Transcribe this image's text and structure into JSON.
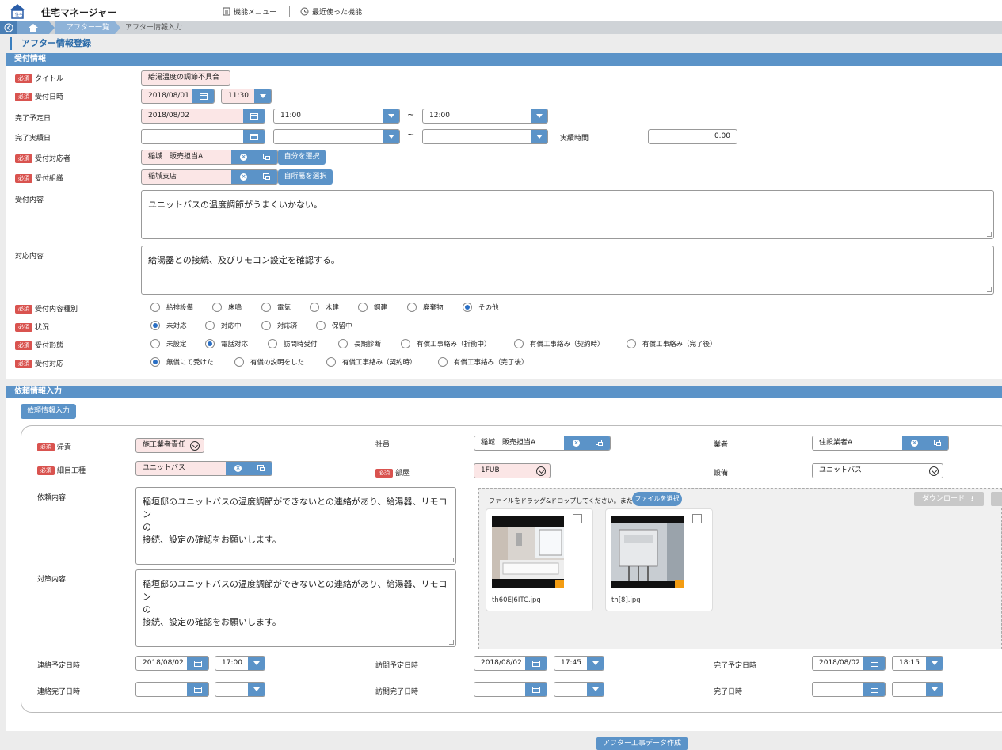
{
  "app": {
    "name": "住宅マネージャー"
  },
  "topmenu": {
    "function_menu": "機能メニュー",
    "recent": "最近使った機能"
  },
  "breadcrumb": {
    "items": [
      "アフター一覧",
      "アフター情報入力"
    ]
  },
  "page_title": "アフター情報登録",
  "reception": {
    "section_title": "受付情報",
    "required_badge": "必須",
    "title_label": "タイトル",
    "title_value": "給湯温度の調節不具合",
    "date_label": "受付日時",
    "date_value": "2018/08/01",
    "time_value": "11:30",
    "planned_label": "完了予定日",
    "planned_date": "2018/08/02",
    "planned_from": "11:00",
    "tilde": "~",
    "planned_to": "12:00",
    "actual_label": "完了実績日",
    "actual_date": "",
    "actual_from": "",
    "actual_to": "",
    "actual_hours_label": "実績時間",
    "actual_hours_value": "0.00",
    "handler_label": "受付対応者",
    "handler_value": "稲城　販売担当A",
    "handler_select_self": "自分を選択",
    "org_label": "受付組織",
    "org_value": "稲城支店",
    "org_select_own": "自所屬を選択",
    "content_label": "受付内容",
    "content_value": "ユニットバスの温度調節がうまくいかない。",
    "response_label": "対応内容",
    "response_value": "給湯器との接続、及びリモコン設定を確認する。",
    "category_label": "受付内容種別",
    "category_options": [
      "給排設備",
      "床鳴",
      "電気",
      "木建",
      "鋼建",
      "廃棄物",
      "その他"
    ],
    "category_selected": "その他",
    "status_label": "状況",
    "status_options": [
      "未対応",
      "対応中",
      "対応済",
      "保留中"
    ],
    "status_selected": "未対応",
    "form_label": "受付形態",
    "form_options": [
      "未設定",
      "電話対応",
      "訪問時受付",
      "長期診断",
      "有償工事絡み（折衝中）",
      "有償工事絡み（契約時）",
      "有償工事絡み（完了後）"
    ],
    "form_selected": "電話対応",
    "resp_label": "受付対応",
    "resp_options": [
      "無償にて受けた",
      "有償の説明をした",
      "有償工事絡み（契約時）",
      "有償工事絡み（完了後）"
    ],
    "resp_selected": "無償にて受けた"
  },
  "request": {
    "section_title": "依頼情報入力",
    "tab_label": "依頼情報入力",
    "attribution_label": "帰責",
    "attribution_value": "施工業者責任",
    "employee_label": "社員",
    "employee_value": "稲城　販売担当A",
    "vendor_label": "業者",
    "vendor_value": "住設業者A",
    "work_label": "細目工種",
    "work_value": "ユニットバス",
    "room_label": "部屋",
    "room_value": "1FUB",
    "equipment_label": "設備",
    "equipment_value": "ユニットバス",
    "request_label": "依頼内容",
    "request_lines": [
      "稲垣邸のユニットバスの温度調節ができないとの連絡があり、給湯器、リモコン",
      "の",
      "接続、設定の確認をお願いします。"
    ],
    "measure_label": "対策内容",
    "measure_lines": [
      "稲垣邸のユニットバスの温度調節ができないとの連絡があり、給湯器、リモコン",
      "の",
      "接続、設定の確認をお願いします。"
    ],
    "drop_text": "ファイルをドラッグ&ドロップしてください。または",
    "file_select": "ファイルを選択",
    "download": "ダウンロード",
    "files": [
      {
        "name": "th60EJ6ITC.jpg"
      },
      {
        "name": "th[8].jpg"
      }
    ],
    "contact_plan_label": "連絡予定日時",
    "contact_plan_date": "2018/08/02",
    "contact_plan_time": "17:00",
    "visit_plan_label": "訪問予定日時",
    "visit_plan_date": "2018/08/02",
    "visit_plan_time": "17:45",
    "complete_plan_label": "完了予定日時",
    "complete_plan_date": "2018/08/02",
    "complete_plan_time": "18:15",
    "contact_done_label": "連絡完了日時",
    "visit_done_label": "訪問完了日時",
    "complete_done_label": "完了日時"
  },
  "footer_button": "アフター工事データ作成",
  "colors": {
    "accent": "#5b93c8",
    "required": "#d9534f",
    "pink_field": "#fbe6e6"
  }
}
